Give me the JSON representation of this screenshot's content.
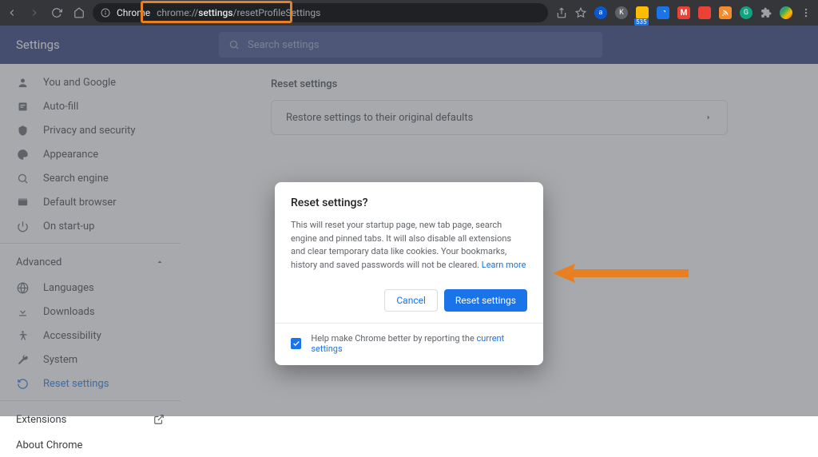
{
  "browser": {
    "address_label": "Chrome",
    "address_url_prefix": "chrome://",
    "address_url_bold": "settings",
    "address_url_suffix": "/resetProfileSettings",
    "bookmark_badge": "535"
  },
  "header": {
    "title": "Settings",
    "search_placeholder": "Search settings"
  },
  "sidebar": {
    "items": [
      {
        "label": "You and Google"
      },
      {
        "label": "Auto-fill"
      },
      {
        "label": "Privacy and security"
      },
      {
        "label": "Appearance"
      },
      {
        "label": "Search engine"
      },
      {
        "label": "Default browser"
      },
      {
        "label": "On start-up"
      }
    ],
    "advanced_label": "Advanced",
    "adv_items": [
      {
        "label": "Languages"
      },
      {
        "label": "Downloads"
      },
      {
        "label": "Accessibility"
      },
      {
        "label": "System"
      },
      {
        "label": "Reset settings"
      }
    ],
    "extensions_label": "Extensions",
    "about_label": "About Chrome"
  },
  "main": {
    "section_title": "Reset settings",
    "row_label": "Restore settings to their original defaults"
  },
  "dialog": {
    "title": "Reset settings?",
    "body_text": "This will reset your startup page, new tab page, search engine and pinned tabs. It will also disable all extensions and clear temporary data like cookies. Your bookmarks, history and saved passwords will not be cleared. ",
    "learn_more": "Learn more",
    "cancel": "Cancel",
    "confirm": "Reset settings",
    "footer_text": "Help make Chrome better by reporting the ",
    "footer_link": "current settings"
  }
}
